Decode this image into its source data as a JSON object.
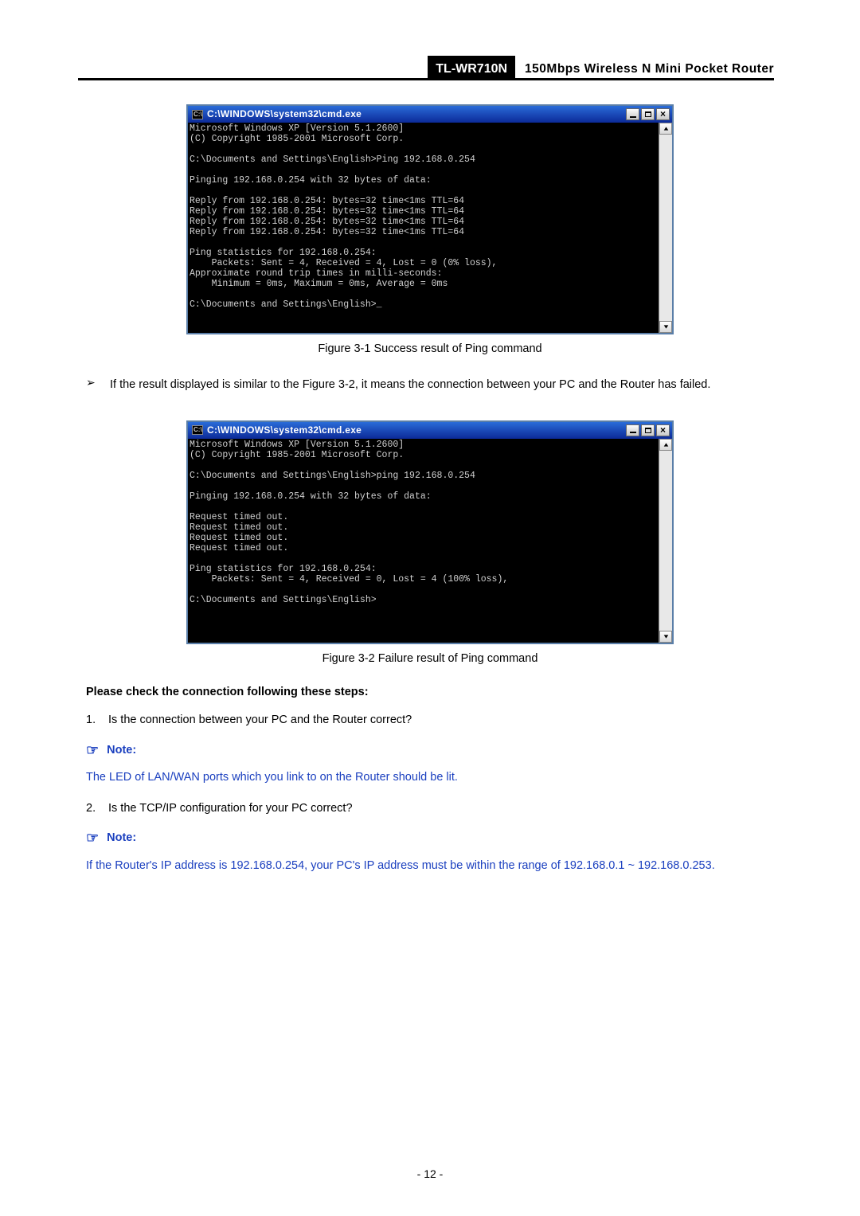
{
  "header": {
    "model": "TL-WR710N",
    "title": "150Mbps  Wireless  N  Mini  Pocket  Router"
  },
  "cmd1": {
    "title": "C:\\WINDOWS\\system32\\cmd.exe",
    "icon_label": "C:\\",
    "lines": "Microsoft Windows XP [Version 5.1.2600]\n(C) Copyright 1985-2001 Microsoft Corp.\n\nC:\\Documents and Settings\\English>Ping 192.168.0.254\n\nPinging 192.168.0.254 with 32 bytes of data:\n\nReply from 192.168.0.254: bytes=32 time<1ms TTL=64\nReply from 192.168.0.254: bytes=32 time<1ms TTL=64\nReply from 192.168.0.254: bytes=32 time<1ms TTL=64\nReply from 192.168.0.254: bytes=32 time<1ms TTL=64\n\nPing statistics for 192.168.0.254:\n    Packets: Sent = 4, Received = 4, Lost = 0 (0% loss),\nApproximate round trip times in milli-seconds:\n    Minimum = 0ms, Maximum = 0ms, Average = 0ms\n\nC:\\Documents and Settings\\English>_"
  },
  "caption1": "Figure 3-1    Success result of Ping command",
  "bullet": {
    "symbol": "➢",
    "text": "If the result displayed is similar to the Figure 3-2, it means the connection between your PC and the Router has failed."
  },
  "cmd2": {
    "title": "C:\\WINDOWS\\system32\\cmd.exe",
    "icon_label": "C:\\",
    "lines": "Microsoft Windows XP [Version 5.1.2600]\n(C) Copyright 1985-2001 Microsoft Corp.\n\nC:\\Documents and Settings\\English>ping 192.168.0.254\n\nPinging 192.168.0.254 with 32 bytes of data:\n\nRequest timed out.\nRequest timed out.\nRequest timed out.\nRequest timed out.\n\nPing statistics for 192.168.0.254:\n    Packets: Sent = 4, Received = 0, Lost = 4 (100% loss),\n\nC:\\Documents and Settings\\English>"
  },
  "caption2": "Figure 3-2    Failure result of Ping command",
  "steps_heading": "Please check the connection following these steps:",
  "step1": {
    "num": "1.",
    "text": "Is the connection between your PC and the Router correct?"
  },
  "note_label": "Note:",
  "note1_text": "The LED of LAN/WAN ports which you link to on the Router should be lit.",
  "step2": {
    "num": "2.",
    "text": "Is the TCP/IP configuration for your PC correct?"
  },
  "note2_text": "If  the  Router's  IP  address  is  192.168.0.254,  your  PC's  IP  address  must  be  within  the  range  of 192.168.0.1 ~ 192.168.0.253.",
  "page_number": "- 12 -",
  "hand_symbol": "☞"
}
